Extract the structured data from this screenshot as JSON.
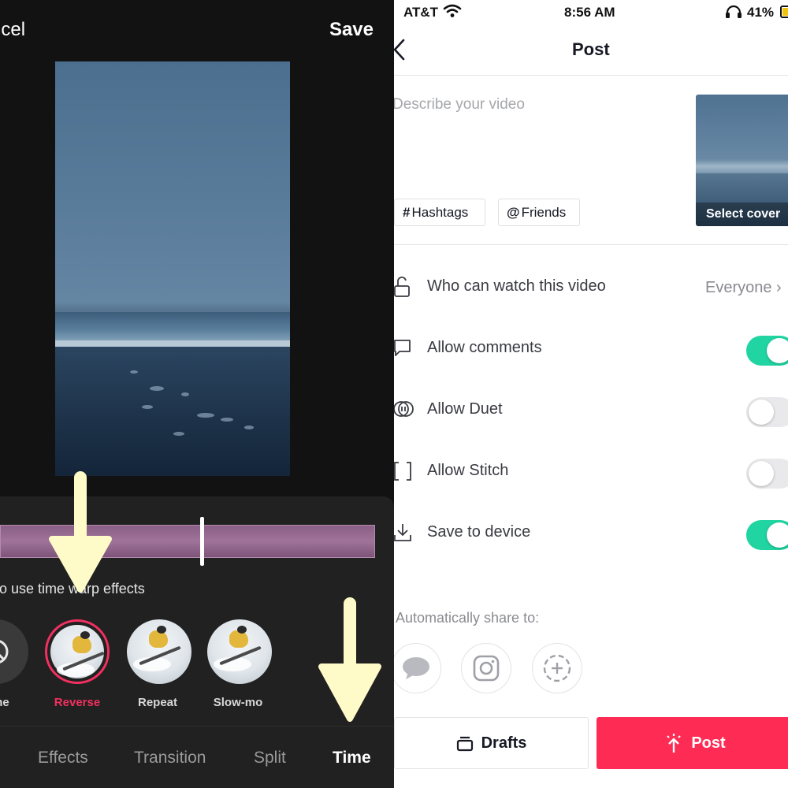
{
  "editor": {
    "cancel_label": "ncel",
    "save_label": "Save",
    "hint": "to use time warp effects",
    "effects": [
      {
        "label": "ne",
        "icon": "none-icon",
        "selected": false
      },
      {
        "label": "Reverse",
        "icon": "skier-thumbnail",
        "selected": true
      },
      {
        "label": "Repeat",
        "icon": "skier-thumbnail",
        "selected": false
      },
      {
        "label": "Slow-mo",
        "icon": "skier-thumbnail",
        "selected": false
      }
    ],
    "tabs": [
      {
        "label": "Effects",
        "active": false
      },
      {
        "label": "Transition",
        "active": false
      },
      {
        "label": "Split",
        "active": false
      },
      {
        "label": "Time",
        "active": true
      }
    ],
    "colors": {
      "accent": "#f2305f",
      "timeline": "#a0739a",
      "arrow": "#fffbc8"
    }
  },
  "post": {
    "status": {
      "carrier": "AT&T",
      "time": "8:56 AM",
      "battery": "41%"
    },
    "title": "Post",
    "description_placeholder": "Describe your video",
    "chips": [
      {
        "symbol": "#",
        "label": "Hashtags"
      },
      {
        "symbol": "@",
        "label": "Friends"
      }
    ],
    "cover_label": "Select cover",
    "settings": {
      "watch": {
        "label": "Who can watch this video",
        "value": "Everyone",
        "icon": "lock-icon"
      },
      "comments": {
        "label": "Allow comments",
        "enabled": true,
        "icon": "comment-icon"
      },
      "duet": {
        "label": "Allow Duet",
        "enabled": false,
        "icon": "duet-icon"
      },
      "stitch": {
        "label": "Allow Stitch",
        "enabled": false,
        "icon": "stitch-icon"
      },
      "save": {
        "label": "Save to device",
        "enabled": true,
        "icon": "download-icon"
      }
    },
    "share_label": "Automatically share to:",
    "share_targets": [
      "messages-icon",
      "instagram-icon",
      "add-icon"
    ],
    "drafts_label": "Drafts",
    "post_label": "Post",
    "colors": {
      "toggle_on": "#20d5a2",
      "post_button": "#fe2c55"
    }
  }
}
